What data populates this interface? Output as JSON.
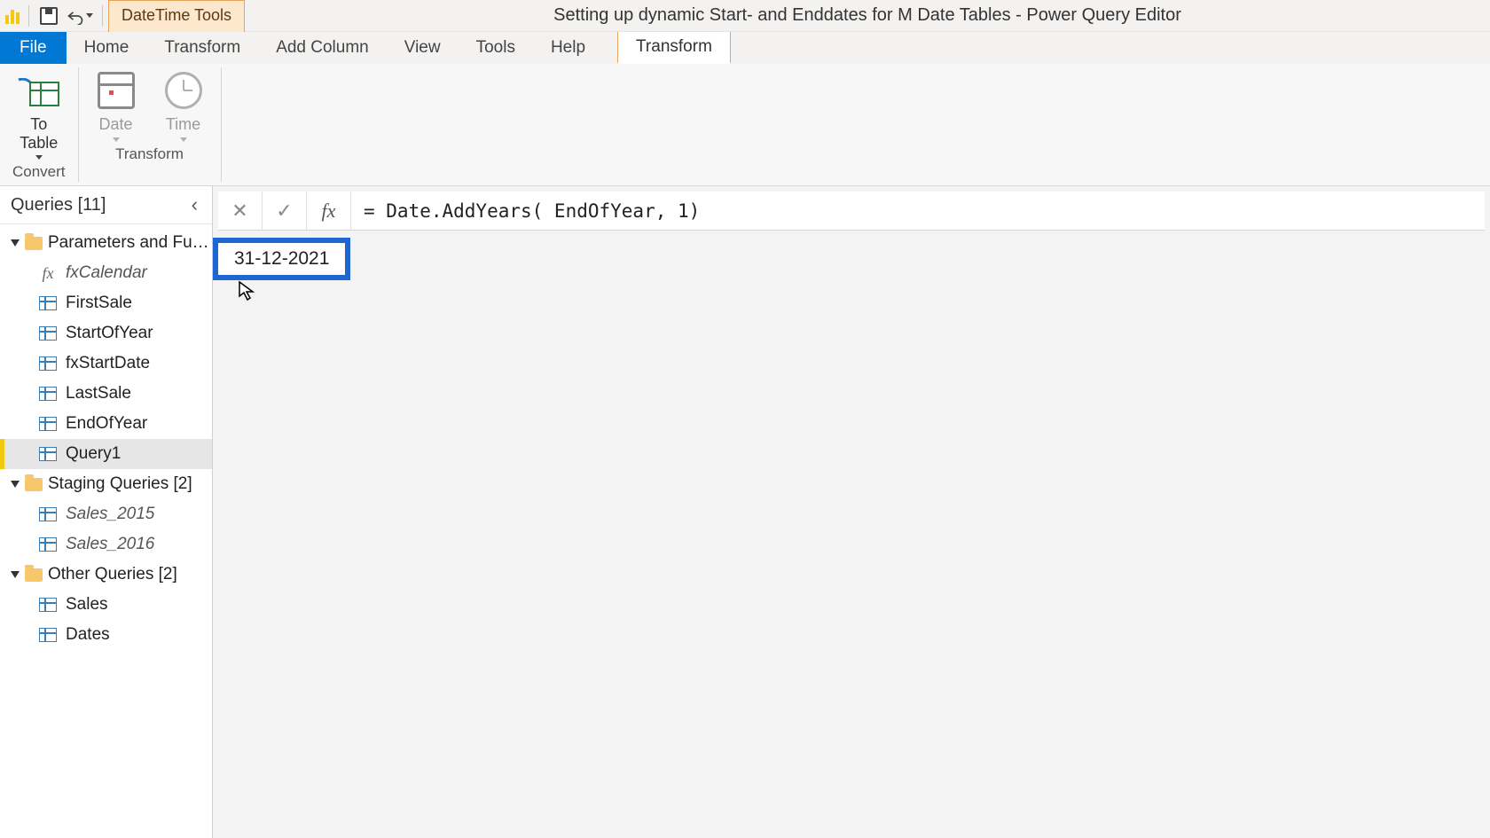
{
  "title": "Setting up dynamic Start- and Enddates for M Date Tables - Power Query Editor",
  "context_tab": "DateTime Tools",
  "menu": {
    "file": "File",
    "tabs": [
      "Home",
      "Transform",
      "Add Column",
      "View",
      "Tools",
      "Help"
    ],
    "context_transform": "Transform"
  },
  "ribbon": {
    "convert": {
      "to_table": "To\nTable",
      "group": "Convert"
    },
    "transform": {
      "date": "Date",
      "time": "Time",
      "group": "Transform"
    }
  },
  "queries": {
    "header": "Queries [11]",
    "groups": [
      {
        "label": "Parameters and Fu…",
        "items": [
          {
            "name": "fxCalendar",
            "icon": "fx",
            "italic": true
          },
          {
            "name": "FirstSale",
            "icon": "table"
          },
          {
            "name": "StartOfYear",
            "icon": "table"
          },
          {
            "name": "fxStartDate",
            "icon": "table"
          },
          {
            "name": "LastSale",
            "icon": "table"
          },
          {
            "name": "EndOfYear",
            "icon": "table"
          },
          {
            "name": "Query1",
            "icon": "table",
            "selected": true
          }
        ]
      },
      {
        "label": "Staging Queries [2]",
        "items": [
          {
            "name": "Sales_2015",
            "icon": "table",
            "italic": true
          },
          {
            "name": "Sales_2016",
            "icon": "table",
            "italic": true
          }
        ]
      },
      {
        "label": "Other Queries [2]",
        "items": [
          {
            "name": "Sales",
            "icon": "table"
          },
          {
            "name": "Dates",
            "icon": "table"
          }
        ]
      }
    ]
  },
  "formula": "= Date.AddYears( EndOfYear, 1)",
  "result_value": "31-12-2021"
}
